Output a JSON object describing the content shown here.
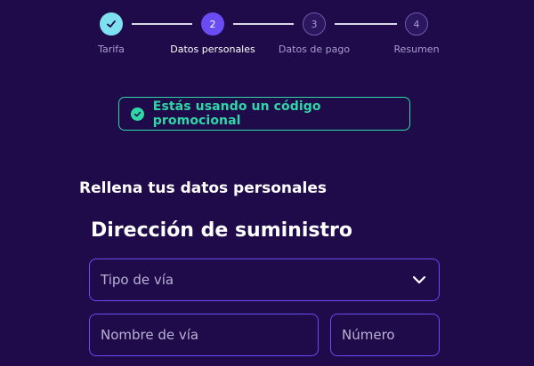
{
  "stepper": {
    "steps": [
      {
        "number": "",
        "label": "Tarifa",
        "state": "done"
      },
      {
        "number": "2",
        "label": "Datos personales",
        "state": "active"
      },
      {
        "number": "3",
        "label": "Datos de pago",
        "state": "pending"
      },
      {
        "number": "4",
        "label": "Resumen",
        "state": "pending"
      }
    ]
  },
  "promo": {
    "text": "Estás usando un código promocional",
    "icon": "check-circle-icon",
    "color": "#2fd6a6"
  },
  "form": {
    "section_title": "Rellena tus datos personales",
    "address_title": "Dirección de suministro",
    "street_type": {
      "placeholder": "Tipo de vía",
      "icon": "chevron-down-icon"
    },
    "street_name": {
      "placeholder": "Nombre de vía"
    },
    "street_number": {
      "placeholder": "Número"
    }
  },
  "colors": {
    "background": "#1f0a4a",
    "accent": "#6a4cf5",
    "done": "#7fe0f0"
  }
}
